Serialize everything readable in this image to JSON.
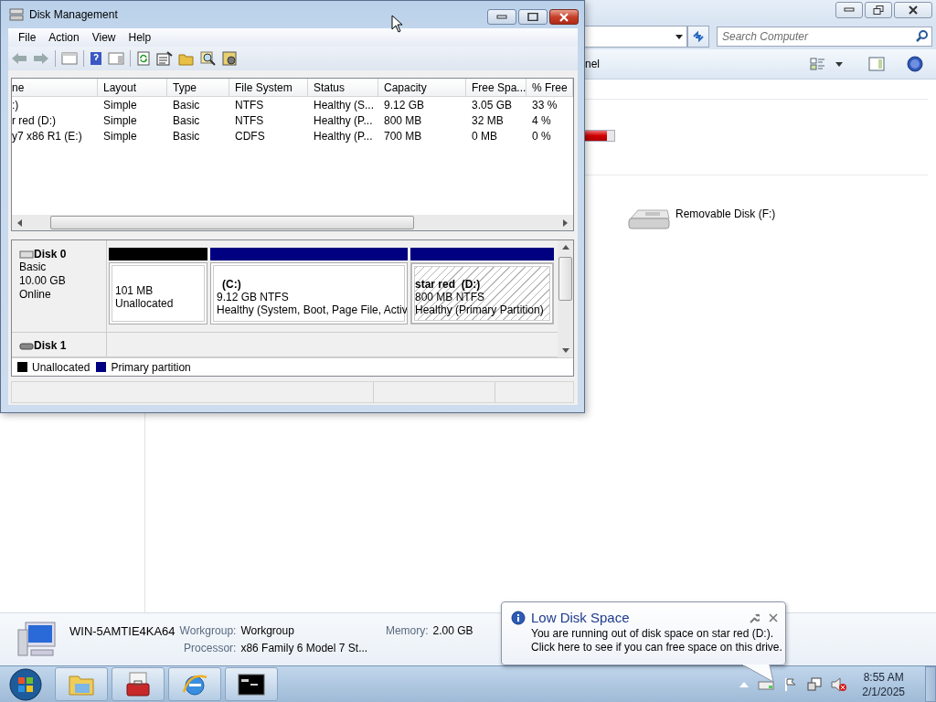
{
  "explorer": {
    "search": {
      "placeholder": "Search Computer"
    },
    "command_bar": {
      "text": "nel"
    },
    "drive_bar": {
      "level": 0.96
    },
    "devices": [
      {
        "label": "Removable Disk (F:)"
      }
    ],
    "details": {
      "computer_name": "WIN-5AMTIE4KA64",
      "fields": [
        {
          "label": "Workgroup:",
          "value": "Workgroup"
        },
        {
          "label": "Memory:",
          "value": "2.00 GB"
        },
        {
          "label": "Processor:",
          "value": "x86 Family 6 Model 7 St..."
        }
      ]
    }
  },
  "disk_management": {
    "title": "Disk Management",
    "menu": [
      "File",
      "Action",
      "View",
      "Help"
    ],
    "volumes": {
      "columns": [
        "ne",
        "Layout",
        "Type",
        "File System",
        "Status",
        "Capacity",
        "Free Spa...",
        "% Free"
      ],
      "rows": [
        [
          ":)",
          "Simple",
          "Basic",
          "NTFS",
          "Healthy (S...",
          "9.12 GB",
          "3.05 GB",
          "33 %"
        ],
        [
          "r red (D:)",
          "Simple",
          "Basic",
          "NTFS",
          "Healthy (P...",
          "800 MB",
          "32 MB",
          "4 %"
        ],
        [
          "y7 x86 R1 (E:)",
          "Simple",
          "Basic",
          "CDFS",
          "Healthy (P...",
          "700 MB",
          "0 MB",
          "0 %"
        ]
      ]
    },
    "disks": [
      {
        "name": "Disk 0",
        "kind": "fixed",
        "info": [
          "Basic",
          "10.00 GB",
          "Online"
        ],
        "partitions": [
          {
            "lines": [
              "101 MB",
              "Unallocated"
            ],
            "color": "#000000",
            "selected": false
          },
          {
            "name": "(C:)",
            "lines": [
              "9.12 GB NTFS",
              "Healthy (System, Boot, Page File, Activ"
            ],
            "color": "#000080",
            "selected": false
          },
          {
            "name": "star red  (D:)",
            "lines": [
              "800 MB NTFS",
              "Healthy (Primary Partition)"
            ],
            "color": "#000080",
            "selected": true
          }
        ]
      },
      {
        "name": "Disk 1",
        "kind": "removable"
      }
    ],
    "legend": [
      {
        "label": "Unallocated",
        "color": "#000000"
      },
      {
        "label": "Primary partition",
        "color": "#000080"
      }
    ]
  },
  "notification": {
    "title": "Low Disk Space",
    "lines": [
      "You are running out of disk space on star red (D:).",
      "Click here to see if you can free space on this drive."
    ]
  },
  "clock": {
    "time": "8:55 AM",
    "date": "2/1/2025"
  }
}
